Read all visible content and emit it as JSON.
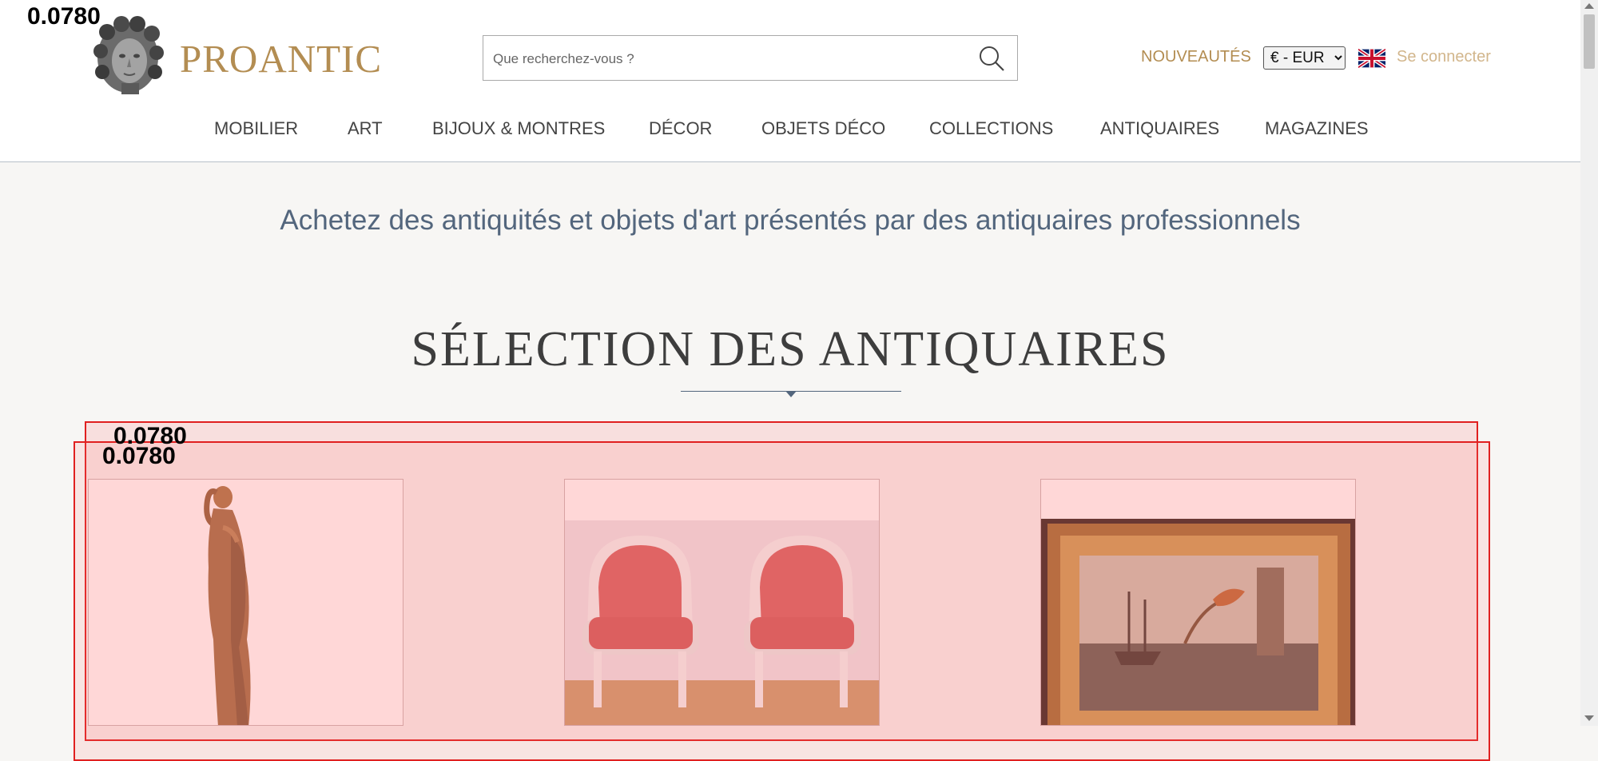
{
  "overlay_scores": [
    "0.0780",
    "0.0780",
    "0.0780"
  ],
  "header": {
    "brand": "PROANTIC",
    "search_placeholder": "Que recherchez-vous ?",
    "news_label": "NOUVEAUTÉS",
    "currency_selected": "€ - EUR",
    "login_label": "Se connecter"
  },
  "nav": {
    "items": [
      {
        "label": "MOBILIER"
      },
      {
        "label": "ART"
      },
      {
        "label": "BIJOUX & MONTRES"
      },
      {
        "label": "DÉCOR"
      },
      {
        "label": "OBJETS DÉCO"
      },
      {
        "label": "COLLECTIONS"
      },
      {
        "label": "ANTIQUAIRES"
      },
      {
        "label": "MAGAZINES"
      }
    ]
  },
  "main": {
    "tagline": "Achetez des antiquités et objets d'art présentés par des antiquaires professionnels",
    "section_title": "SÉLECTION DES ANTIQUAIRES"
  },
  "colors": {
    "gold": "#b38d52",
    "slate": "#53667d",
    "highlight_red": "#e02020"
  }
}
